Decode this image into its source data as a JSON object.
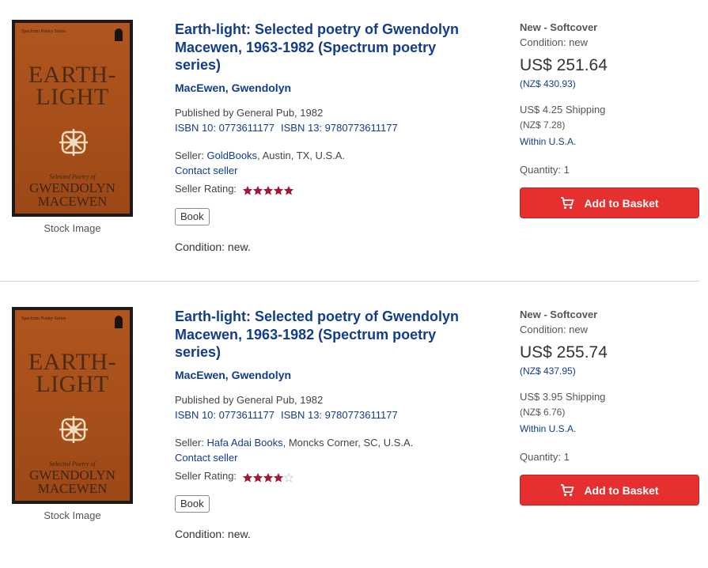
{
  "listings": [
    {
      "cover": {
        "series": "Spectrum Poetry Series",
        "title_line1": "EARTH-",
        "title_line2": "LIGHT",
        "subtitle": "Selected Poetry of",
        "author_line1": "GWENDOLYN",
        "author_line2": "MACEWEN"
      },
      "stock_caption": "Stock Image",
      "title": "Earth-light: Selected poetry of Gwendolyn Macewen, 1963-1982 (Spectrum poetry series)",
      "author": "MacEwen, Gwendolyn",
      "publisher": "Published by General Pub, 1982",
      "isbn10": "ISBN 10: 0773611177",
      "isbn13": "ISBN 13: 9780773611177",
      "seller_prefix": "Seller: ",
      "seller_name": "GoldBooks",
      "seller_location": ", Austin, TX, U.S.A.",
      "contact": "Contact seller",
      "rating_label": "Seller Rating:",
      "rating": 5,
      "rating_max": 5,
      "badge": "Book",
      "condition_text": "Condition: new.",
      "binding": "New - Softcover",
      "condition": "Condition: new",
      "price": "US$ 251.64",
      "price_alt": "(NZ$ 430.93)",
      "shipping": "US$ 4.25 Shipping",
      "shipping_alt": "(NZ$ 7.28)",
      "ship_location": "Within U.S.A.",
      "quantity": "Quantity: 1",
      "basket_label": "Add to Basket"
    },
    {
      "cover": {
        "series": "Spectrum Poetry Series",
        "title_line1": "EARTH-",
        "title_line2": "LIGHT",
        "subtitle": "Selected Poetry of",
        "author_line1": "GWENDOLYN",
        "author_line2": "MACEWEN"
      },
      "stock_caption": "Stock Image",
      "title": "Earth-light: Selected poetry of Gwendolyn Macewen, 1963-1982 (Spectrum poetry series)",
      "author": "MacEwen, Gwendolyn",
      "publisher": "Published by General Pub, 1982",
      "isbn10": "ISBN 10: 0773611177",
      "isbn13": "ISBN 13: 9780773611177",
      "seller_prefix": "Seller: ",
      "seller_name": "Hafa Adai Books",
      "seller_location": ", Moncks Corner, SC, U.S.A.",
      "contact": "Contact seller",
      "rating_label": "Seller Rating:",
      "rating": 4,
      "rating_max": 5,
      "badge": "Book",
      "condition_text": "Condition: new.",
      "binding": "New - Softcover",
      "condition": "Condition: new",
      "price": "US$ 255.74",
      "price_alt": "(NZ$ 437.95)",
      "shipping": "US$ 3.95 Shipping",
      "shipping_alt": "(NZ$ 6.76)",
      "ship_location": "Within U.S.A.",
      "quantity": "Quantity: 1",
      "basket_label": "Add to Basket"
    }
  ],
  "colors": {
    "link": "#123d8a",
    "button": "#e5302f",
    "star_filled": "#9b1b3a",
    "star_empty": "#c8c8c8"
  },
  "icons": {
    "cart": "cart-icon",
    "star": "star-icon",
    "emblem": "cover-emblem"
  }
}
